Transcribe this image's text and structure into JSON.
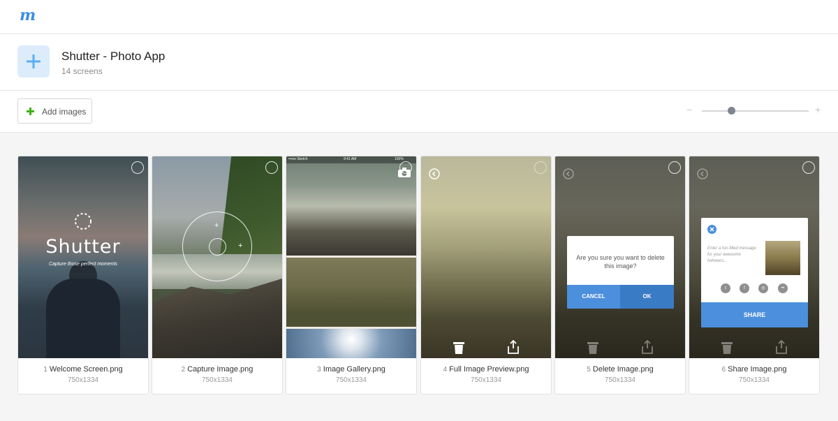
{
  "app": {
    "logo": "m"
  },
  "project": {
    "title": "Shutter - Photo App",
    "subtitle": "14 screens"
  },
  "toolbar": {
    "add_images_label": "Add images",
    "zoom_minus": "−",
    "zoom_plus": "+"
  },
  "colors": {
    "accent": "#3b8ee0",
    "add_green": "#3fb21a",
    "dialog_blue": "#4b8fdd"
  },
  "screens": [
    {
      "num": "1",
      "name": "Welcome Screen.png",
      "size": "750x1334",
      "brand": "Shutter",
      "tagline": "Capture those perfect moments"
    },
    {
      "num": "2",
      "name": "Capture Image.png",
      "size": "750x1334"
    },
    {
      "num": "3",
      "name": "Image Gallery.png",
      "size": "750x1334",
      "status_left": "•••oo Sketch",
      "status_time": "9:41 AM",
      "status_right": "100%"
    },
    {
      "num": "4",
      "name": "Full Image Preview.png",
      "size": "750x1334"
    },
    {
      "num": "5",
      "name": "Delete Image.png",
      "size": "750x1334",
      "dialog_message": "Are you sure you want to delete this image?",
      "cancel": "CANCEL",
      "ok": "OK"
    },
    {
      "num": "6",
      "name": "Share Image.png",
      "size": "750x1334",
      "share_hint": "Enter a fun-filled message for your awesome followers...",
      "share_button": "SHARE",
      "social_icons": [
        "twitter-icon",
        "facebook-icon",
        "instagram-icon",
        "flickr-icon"
      ]
    }
  ]
}
